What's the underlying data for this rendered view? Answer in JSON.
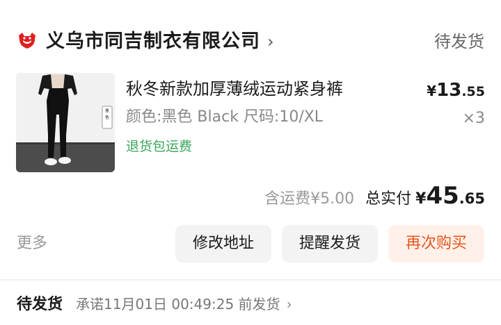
{
  "shop": {
    "name": "义乌市同吉制衣有限公司",
    "chevron": "›",
    "status": "待发货",
    "icon": "tmall-cat-icon",
    "icon_color": "#e02020"
  },
  "product": {
    "title": "秋冬新款加厚薄绒运动紧身裤",
    "spec": "颜色:黑色 Black  尺码:10/XL",
    "tag": "退货包运费",
    "tag_color": "#3aa55a",
    "price_symbol": "¥",
    "price_int": "13",
    "price_dec": ".55",
    "quantity": "×3",
    "thumb_label": "黑色"
  },
  "summary": {
    "shipping_note": "含运费¥5.00",
    "total_label": "总实付",
    "total_symbol": "¥",
    "total_int": "45",
    "total_dec": ".65"
  },
  "actions": {
    "more": "更多",
    "modify_address": "修改地址",
    "remind_ship": "提醒发货",
    "rebuy": "再次购买",
    "rebuy_color": "#e6561c"
  },
  "next_order": {
    "status": "待发货",
    "promise": "承诺11月01日 00:49:25 前发货",
    "chevron": "›"
  }
}
